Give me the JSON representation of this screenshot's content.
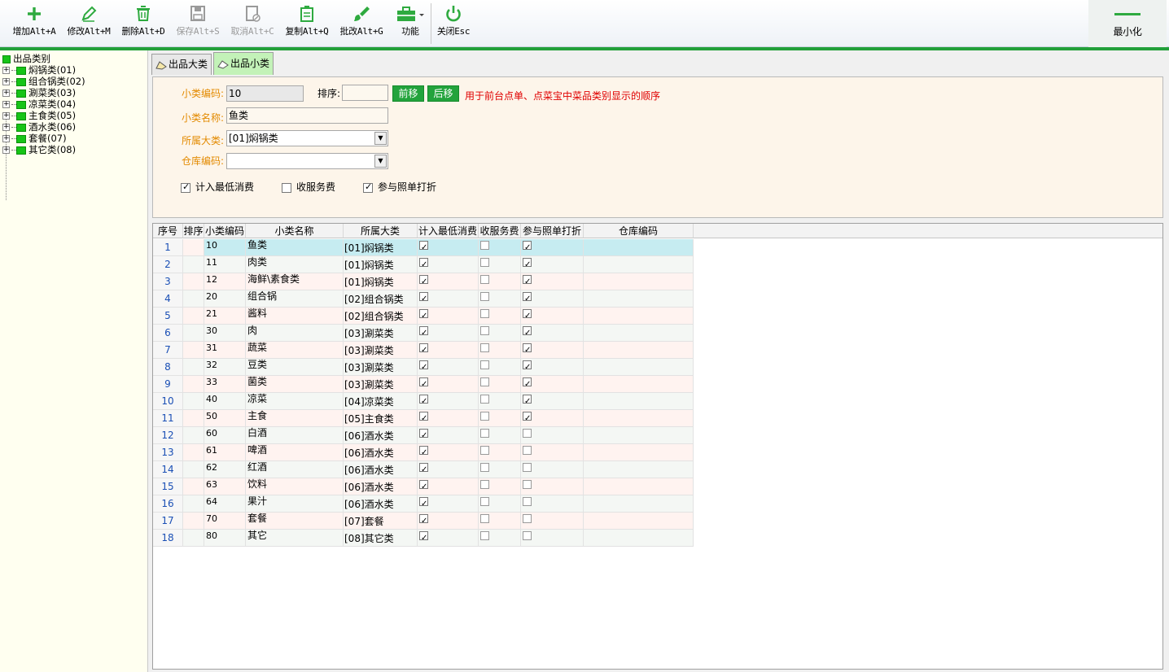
{
  "toolbar": {
    "buttons": [
      {
        "label": "增加Alt+A",
        "icon": "plus-icon",
        "enabled": true
      },
      {
        "label": "修改Alt+M",
        "icon": "pencil-icon",
        "enabled": true
      },
      {
        "label": "删除Alt+D",
        "icon": "trash-icon",
        "enabled": true
      },
      {
        "label": "保存Alt+S",
        "icon": "floppy-icon",
        "enabled": false
      },
      {
        "label": "取消Alt+C",
        "icon": "cancel-doc-icon",
        "enabled": false
      },
      {
        "label": "复制Alt+Q",
        "icon": "clipboard-icon",
        "enabled": true
      },
      {
        "label": "批改Alt+G",
        "icon": "brush-icon",
        "enabled": true
      },
      {
        "label": "功能",
        "icon": "toolbox-icon",
        "enabled": true
      },
      {
        "label": "关闭Esc",
        "icon": "power-icon",
        "enabled": true
      }
    ],
    "minimize_label": "最小化",
    "accent_color": "#22a03a"
  },
  "tree": {
    "root": "出品类别",
    "items": [
      "焖锅类(01)",
      "组合锅类(02)",
      "涮菜类(03)",
      "凉菜类(04)",
      "主食类(05)",
      "酒水类(06)",
      "套餐(07)",
      "其它类(08)"
    ]
  },
  "tabs": [
    {
      "label": "出品大类",
      "active": false
    },
    {
      "label": "出品小类",
      "active": true
    }
  ],
  "form": {
    "code_label": "小类编码:",
    "code_value": "10",
    "sort_label": "排序:",
    "sort_value": "",
    "move_up": "前移",
    "move_down": "后移",
    "hint": "用于前台点单、点菜宝中菜品类别显示的顺序",
    "name_label": "小类名称:",
    "name_value": "鱼类",
    "parent_label": "所属大类:",
    "parent_value": "[01]焖锅类",
    "warehouse_label": "仓库编码:",
    "warehouse_value": "",
    "chk_min": {
      "label": "计入最低消费",
      "checked": true
    },
    "chk_service": {
      "label": "收服务费",
      "checked": false
    },
    "chk_discount": {
      "label": "参与照单打折",
      "checked": true
    }
  },
  "grid": {
    "headers": [
      "序号",
      "排序",
      "小类编码",
      "小类名称",
      "所属大类",
      "计入最低消费",
      "收服务费",
      "参与照单打折",
      "仓库编码"
    ],
    "rows": [
      {
        "no": "1",
        "sort": "",
        "code": "10",
        "name": "鱼类",
        "parent": "[01]焖锅类",
        "min": true,
        "svc": false,
        "disc": true,
        "wh": ""
      },
      {
        "no": "2",
        "sort": "",
        "code": "11",
        "name": "肉类",
        "parent": "[01]焖锅类",
        "min": true,
        "svc": false,
        "disc": true,
        "wh": ""
      },
      {
        "no": "3",
        "sort": "",
        "code": "12",
        "name": "海鲜\\素食类",
        "parent": "[01]焖锅类",
        "min": true,
        "svc": false,
        "disc": true,
        "wh": ""
      },
      {
        "no": "4",
        "sort": "",
        "code": "20",
        "name": "组合锅",
        "parent": "[02]组合锅类",
        "min": true,
        "svc": false,
        "disc": true,
        "wh": ""
      },
      {
        "no": "5",
        "sort": "",
        "code": "21",
        "name": "酱料",
        "parent": "[02]组合锅类",
        "min": true,
        "svc": false,
        "disc": true,
        "wh": ""
      },
      {
        "no": "6",
        "sort": "",
        "code": "30",
        "name": "肉",
        "parent": "[03]涮菜类",
        "min": true,
        "svc": false,
        "disc": true,
        "wh": ""
      },
      {
        "no": "7",
        "sort": "",
        "code": "31",
        "name": "蔬菜",
        "parent": "[03]涮菜类",
        "min": true,
        "svc": false,
        "disc": true,
        "wh": ""
      },
      {
        "no": "8",
        "sort": "",
        "code": "32",
        "name": "豆类",
        "parent": "[03]涮菜类",
        "min": true,
        "svc": false,
        "disc": true,
        "wh": ""
      },
      {
        "no": "9",
        "sort": "",
        "code": "33",
        "name": "菌类",
        "parent": "[03]涮菜类",
        "min": true,
        "svc": false,
        "disc": true,
        "wh": ""
      },
      {
        "no": "10",
        "sort": "",
        "code": "40",
        "name": "凉菜",
        "parent": "[04]凉菜类",
        "min": true,
        "svc": false,
        "disc": true,
        "wh": ""
      },
      {
        "no": "11",
        "sort": "",
        "code": "50",
        "name": "主食",
        "parent": "[05]主食类",
        "min": true,
        "svc": false,
        "disc": true,
        "wh": ""
      },
      {
        "no": "12",
        "sort": "",
        "code": "60",
        "name": "白酒",
        "parent": "[06]酒水类",
        "min": true,
        "svc": false,
        "disc": false,
        "wh": ""
      },
      {
        "no": "13",
        "sort": "",
        "code": "61",
        "name": "啤酒",
        "parent": "[06]酒水类",
        "min": true,
        "svc": false,
        "disc": false,
        "wh": ""
      },
      {
        "no": "14",
        "sort": "",
        "code": "62",
        "name": "红酒",
        "parent": "[06]酒水类",
        "min": true,
        "svc": false,
        "disc": false,
        "wh": ""
      },
      {
        "no": "15",
        "sort": "",
        "code": "63",
        "name": "饮料",
        "parent": "[06]酒水类",
        "min": true,
        "svc": false,
        "disc": false,
        "wh": ""
      },
      {
        "no": "16",
        "sort": "",
        "code": "64",
        "name": "果汁",
        "parent": "[06]酒水类",
        "min": true,
        "svc": false,
        "disc": false,
        "wh": ""
      },
      {
        "no": "17",
        "sort": "",
        "code": "70",
        "name": "套餐",
        "parent": "[07]套餐",
        "min": true,
        "svc": false,
        "disc": false,
        "wh": ""
      },
      {
        "no": "18",
        "sort": "",
        "code": "80",
        "name": "其它",
        "parent": "[08]其它类",
        "min": true,
        "svc": false,
        "disc": false,
        "wh": ""
      }
    ],
    "selected_row": 1
  }
}
